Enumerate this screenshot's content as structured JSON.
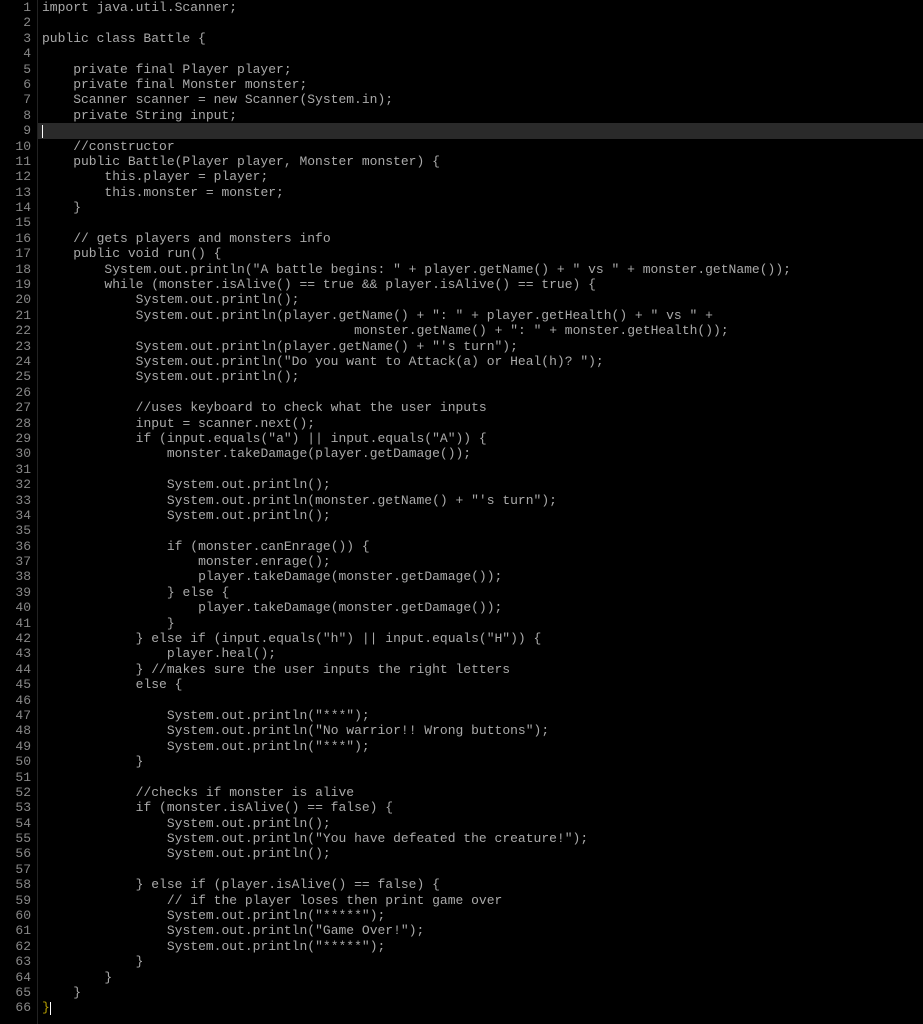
{
  "highlighted_line": 9,
  "indent_guides": true,
  "filename": "Battle.java",
  "language": "Java",
  "code_lines": [
    "import java.util.Scanner;",
    "",
    "public class Battle {",
    "",
    "    private final Player player;",
    "    private final Monster monster;",
    "    Scanner scanner = new Scanner(System.in);",
    "    private String input;",
    "",
    "    //constructor",
    "    public Battle(Player player, Monster monster) {",
    "        this.player = player;",
    "        this.monster = monster;",
    "    }",
    "",
    "    // gets players and monsters info",
    "    public void run() {",
    "        System.out.println(\"A battle begins: \" + player.getName() + \" vs \" + monster.getName());",
    "        while (monster.isAlive() == true && player.isAlive() == true) {",
    "            System.out.println();",
    "            System.out.println(player.getName() + \": \" + player.getHealth() + \" vs \" +",
    "                                        monster.getName() + \": \" + monster.getHealth());",
    "            System.out.println(player.getName() + \"'s turn\");",
    "            System.out.println(\"Do you want to Attack(a) or Heal(h)? \");",
    "            System.out.println();",
    "",
    "            //uses keyboard to check what the user inputs",
    "            input = scanner.next();",
    "            if (input.equals(\"a\") || input.equals(\"A\")) {",
    "                monster.takeDamage(player.getDamage());",
    "",
    "                System.out.println();",
    "                System.out.println(monster.getName() + \"'s turn\");",
    "                System.out.println();",
    "",
    "                if (monster.canEnrage()) {",
    "                    monster.enrage();",
    "                    player.takeDamage(monster.getDamage());",
    "                } else {",
    "                    player.takeDamage(monster.getDamage());",
    "                }",
    "            } else if (input.equals(\"h\") || input.equals(\"H\")) {",
    "                player.heal();",
    "            } //makes sure the user inputs the right letters",
    "            else {",
    "",
    "                System.out.println(\"***\");",
    "                System.out.println(\"No warrior!! Wrong buttons\");",
    "                System.out.println(\"***\");",
    "            }",
    "",
    "            //checks if monster is alive",
    "            if (monster.isAlive() == false) {",
    "                System.out.println();",
    "                System.out.println(\"You have defeated the creature!\");",
    "                System.out.println();",
    "",
    "            } else if (player.isAlive() == false) {",
    "                // if the player loses then print game over",
    "                System.out.println(\"*****\");",
    "                System.out.println(\"Game Over!\");",
    "                System.out.println(\"*****\");",
    "            }",
    "        }",
    "    }",
    "}"
  ]
}
